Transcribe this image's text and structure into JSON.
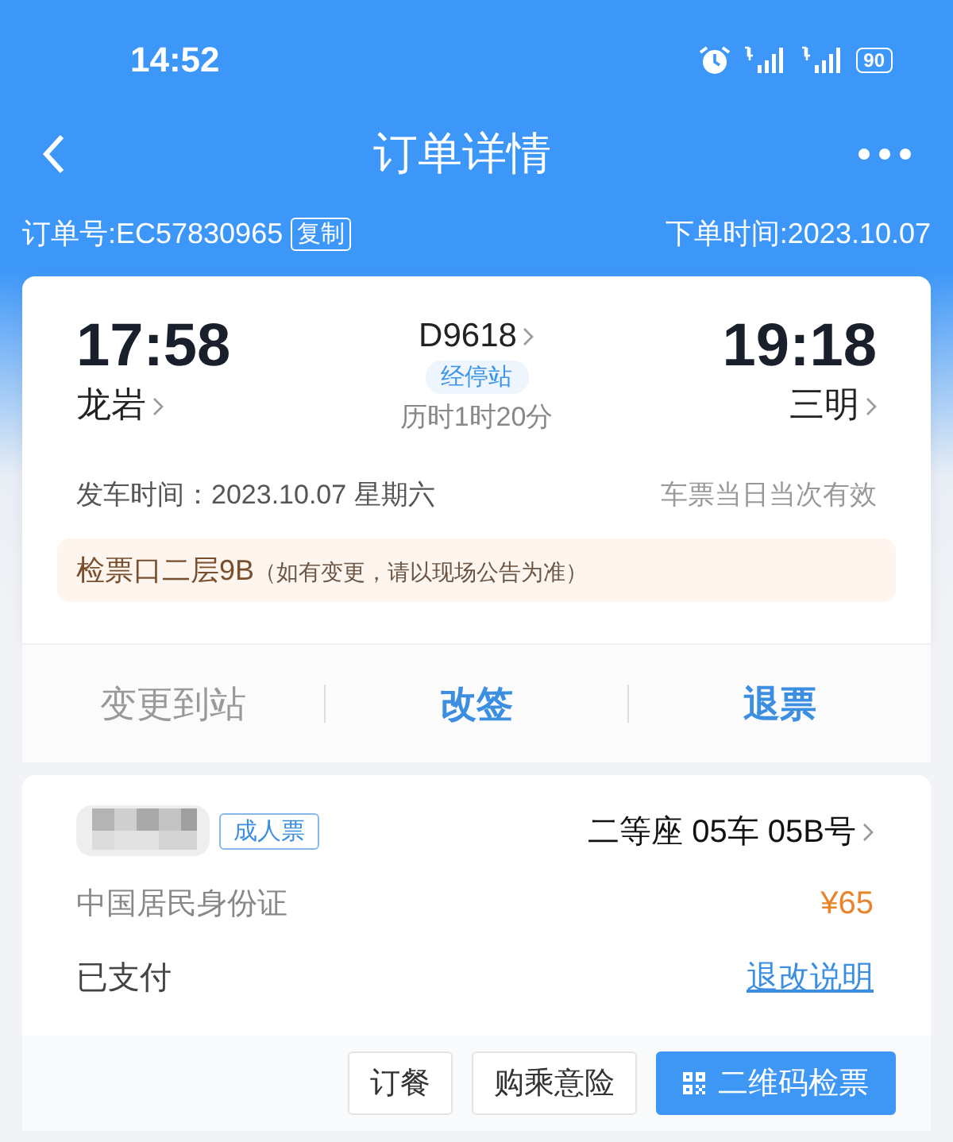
{
  "status_bar": {
    "time": "14:52",
    "battery": "90"
  },
  "header": {
    "title": "订单详情"
  },
  "order": {
    "number": "订单号:EC57830965",
    "copy_button": "复制",
    "placed": "下单时间:2023.10.07"
  },
  "trip": {
    "depart_time": "17:58",
    "depart_station": "龙岩",
    "train": "D9618",
    "stops_button": "经停站",
    "duration": "历时1时20分",
    "arrive_time": "19:18",
    "arrive_station": "三明",
    "date": "发车时间：2023.10.07 星期六",
    "validity": "车票当日当次有效",
    "gate": "检票口二层9B",
    "gate_note": "（如有变更，请以现场公告为准）"
  },
  "actions": [
    {
      "label": "变更到站",
      "disabled": true
    },
    {
      "label": "改签",
      "disabled": false
    },
    {
      "label": "退票",
      "disabled": false
    }
  ],
  "passenger": {
    "ticket_type": "成人票",
    "seat": "二等座 05车 05B号",
    "id_type": "中国居民身份证",
    "price": "¥65",
    "payment": "已支付",
    "rules_link": "退改说明"
  },
  "buttons": [
    {
      "label": "订餐",
      "kind": "plain"
    },
    {
      "label": "购乘意险",
      "kind": "plain"
    },
    {
      "label": "二维码检票",
      "kind": "primary"
    }
  ]
}
